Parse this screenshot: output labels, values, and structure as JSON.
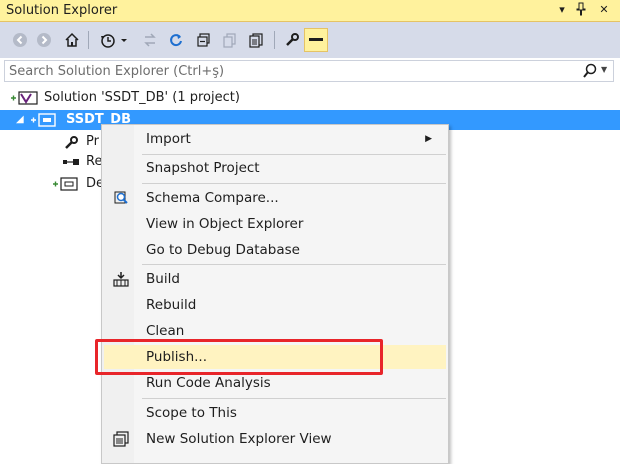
{
  "window": {
    "title": "Solution Explorer",
    "buttons": {
      "dropdown": "▾",
      "pin": "ᵖ",
      "close": "✕"
    }
  },
  "toolbar": {
    "items": [
      "back-icon",
      "forward-icon",
      "home-icon",
      "history-icon",
      "sync-icon",
      "refresh-icon",
      "collapse-all-icon",
      "copy-icon",
      "show-all-files-icon",
      "properties-icon",
      "preview-icon"
    ]
  },
  "search": {
    "placeholder": "Search Solution Explorer (Ctrl+ş)"
  },
  "tree": {
    "solution": {
      "label": "Solution 'SSDT_DB' (1 project)"
    },
    "project": {
      "label": "SSDT_DB"
    },
    "children": [
      {
        "label": "Pr",
        "icon": "wrench-icon"
      },
      {
        "label": "Re",
        "icon": "references-icon"
      },
      {
        "label": "De",
        "icon": "database-icon"
      }
    ]
  },
  "context_menu": {
    "items": [
      {
        "label": "Import",
        "has_submenu": true
      },
      {
        "label": "Snapshot Project"
      },
      {
        "label": "Schema Compare...",
        "icon": "schema-compare-icon"
      },
      {
        "label": "View in Object Explorer"
      },
      {
        "label": "Go to Debug Database"
      },
      {
        "label": "Build",
        "icon": "build-icon"
      },
      {
        "label": "Rebuild"
      },
      {
        "label": "Clean"
      },
      {
        "label": "Publish...",
        "hover": true
      },
      {
        "label": "Run Code Analysis"
      },
      {
        "label": "Scope to This"
      },
      {
        "label": "New Solution Explorer View",
        "icon": "new-view-icon"
      }
    ],
    "submenu_arrow": "▶"
  },
  "colors": {
    "title_bg": "#fff29d",
    "toolbar_bg": "#d6dbe9",
    "selection": "#3399ff",
    "menu_hover": "#fff3c1",
    "highlight_border": "#e8252a"
  }
}
